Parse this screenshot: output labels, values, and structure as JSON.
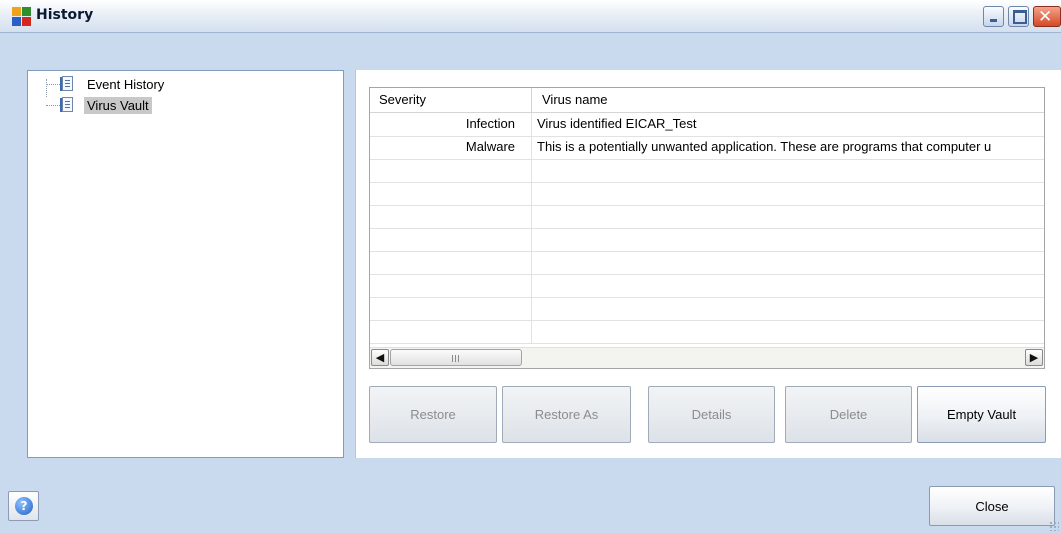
{
  "window": {
    "title": "History"
  },
  "tree": {
    "items": [
      {
        "label": "Event History",
        "selected": false
      },
      {
        "label": "Virus Vault",
        "selected": true
      }
    ]
  },
  "table": {
    "columns": [
      "Severity",
      "Virus name"
    ],
    "rows": [
      {
        "severity": "Infection",
        "name": "Virus identified EICAR_Test"
      },
      {
        "severity": "Malware",
        "name": "This is a potentially unwanted application. These are programs that computer u"
      }
    ]
  },
  "actions": {
    "restore": "Restore",
    "restore_as": "Restore As",
    "details": "Details",
    "delete": "Delete",
    "empty_vault": "Empty Vault"
  },
  "footer": {
    "close": "Close",
    "help_glyph": "?"
  },
  "icons": {
    "scroll_left": "◀",
    "scroll_right": "▶",
    "minimize": "minimize-icon",
    "maximize": "maximize-icon",
    "close": "✕"
  }
}
